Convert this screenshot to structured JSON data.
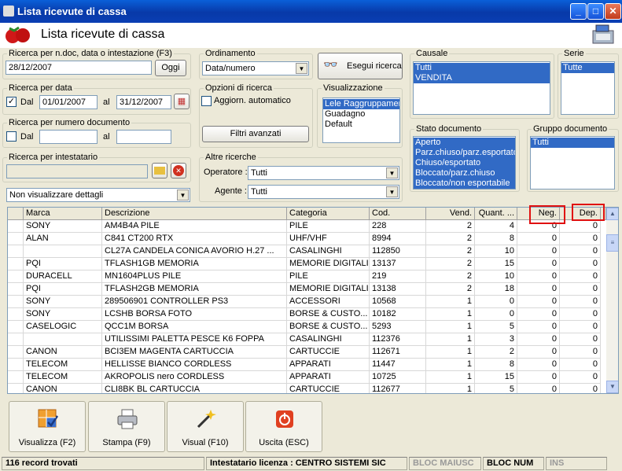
{
  "window": {
    "title": "Lista ricevute di cassa"
  },
  "header": {
    "title": "Lista ricevute di cassa"
  },
  "search_doc": {
    "legend": "Ricerca per n.doc, data o intestazione (F3)",
    "value": "28/12/2007",
    "button": "Oggi"
  },
  "ordinamento": {
    "legend": "Ordinamento",
    "value": "Data/numero"
  },
  "esegui": {
    "label": "Esegui ricerca"
  },
  "search_date": {
    "legend": "Ricerca per data",
    "checked": true,
    "dal_label": "Dal",
    "dal": "01/01/2007",
    "al_label": "al",
    "al": "31/12/2007"
  },
  "search_num": {
    "legend": "Ricerca per numero documento",
    "dal_label": "Dal",
    "al_label": "al"
  },
  "search_int": {
    "legend": "Ricerca per intestatario"
  },
  "detail_select": {
    "value": "Non visualizzare dettagli"
  },
  "opzioni": {
    "legend": "Opzioni di ricerca",
    "auto_label": "Aggiorn. automatico",
    "filtri": "Filtri avanzati"
  },
  "visualizzazione": {
    "legend": "Visualizzazione",
    "items": [
      "Lele Raggruppamento",
      "Guadagno",
      "Default"
    ],
    "selected": 0
  },
  "altre": {
    "legend": "Altre ricerche",
    "operatore_label": "Operatore :",
    "operatore": "Tutti",
    "agente_label": "Agente :",
    "agente": "Tutti"
  },
  "causale": {
    "legend": "Causale",
    "items": [
      "Tutti",
      "VENDITA"
    ]
  },
  "serie": {
    "legend": "Serie",
    "items": [
      "Tutte"
    ]
  },
  "stato": {
    "legend": "Stato documento",
    "items": [
      "Aperto",
      "Parz.chiuso/parz.esportato",
      "Chiuso/esportato",
      "Bloccato/parz.chiuso",
      "Bloccato/non esportabile"
    ]
  },
  "gruppo": {
    "legend": "Gruppo documento",
    "items": [
      "Tutti"
    ]
  },
  "grid": {
    "columns": [
      "Marca",
      "Descrizione",
      "Categoria",
      "Cod.",
      "Vend.",
      "Quant. ...",
      "Neg.",
      "Dep."
    ],
    "rows": [
      [
        "SONY",
        "AM4B4A   PILE",
        "PILE",
        "228",
        "2",
        "4",
        "0",
        "0"
      ],
      [
        "ALAN",
        "C841   CT200 RTX",
        "UHF/VHF",
        "8994",
        "2",
        "8",
        "0",
        "0"
      ],
      [
        "",
        "CL27A  CANDELA CONICA AVORIO H.27      ...",
        "CASALINGHI",
        "112850",
        "2",
        "10",
        "0",
        "0"
      ],
      [
        "PQI",
        "TFLASH1GB   MEMORIA",
        "MEMORIE DIGITALI",
        "13137",
        "2",
        "15",
        "0",
        "0"
      ],
      [
        "DURACELL",
        "MN1604PLUS   PILE",
        "PILE",
        "219",
        "2",
        "10",
        "0",
        "0"
      ],
      [
        "PQI",
        "TFLASH2GB   MEMORIA",
        "MEMORIE DIGITALI",
        "13138",
        "2",
        "18",
        "0",
        "0"
      ],
      [
        "SONY",
        "289506901   CONTROLLER PS3",
        "ACCESSORI",
        "10568",
        "1",
        "0",
        "0",
        "0"
      ],
      [
        "SONY",
        "LCSHB   BORSA FOTO",
        "BORSE & CUSTO...",
        "10182",
        "1",
        "0",
        "0",
        "0"
      ],
      [
        "CASELOGIC",
        "QCC1M   BORSA",
        "BORSE & CUSTO...",
        "5293",
        "1",
        "5",
        "0",
        "0"
      ],
      [
        "",
        "UTILISSIMI PALETTA PESCE K6 FOPPA",
        "CASALINGHI",
        "112376",
        "1",
        "3",
        "0",
        "0"
      ],
      [
        "CANON",
        "BCI3EM MAGENTA   CARTUCCIA",
        "CARTUCCIE",
        "112671",
        "1",
        "2",
        "0",
        "0"
      ],
      [
        "TELECOM",
        "HELLISSE BIANCO   CORDLESS",
        "APPARATI",
        "11447",
        "1",
        "8",
        "0",
        "0"
      ],
      [
        "TELECOM",
        "AKROPOLIS nero   CORDLESS",
        "APPARATI",
        "10725",
        "1",
        "15",
        "0",
        "0"
      ],
      [
        "CANON",
        "CLI8BK BL   CARTUCCIA",
        "CARTUCCIE",
        "112677",
        "1",
        "5",
        "0",
        "0"
      ]
    ]
  },
  "toolbar": {
    "visualizza": "Visualizza (F2)",
    "stampa": "Stampa (F9)",
    "visual": "Visual (F10)",
    "uscita": "Uscita (ESC)"
  },
  "status": {
    "records": "116 record trovati",
    "licenza": "Intestatario licenza : CENTRO SISTEMI SIC",
    "maiusc": "BLOC MAIUSC",
    "num": "BLOC NUM",
    "ins": "INS"
  }
}
